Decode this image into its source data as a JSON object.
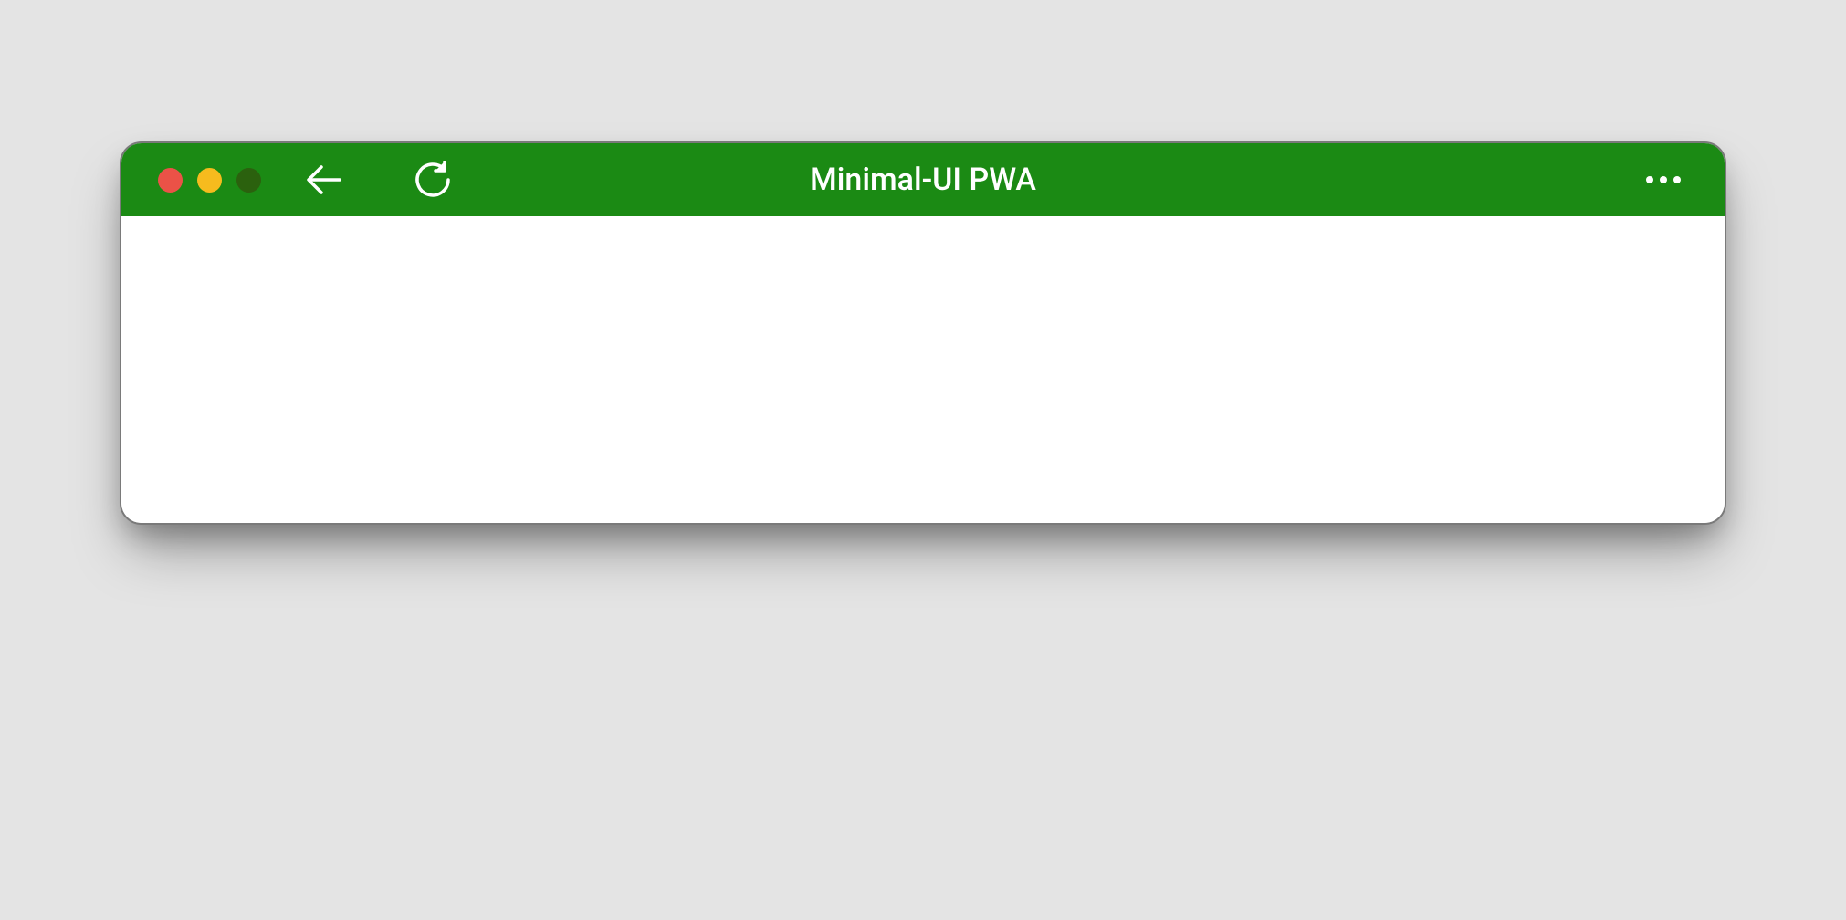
{
  "window": {
    "title": "Minimal-UI PWA"
  },
  "colors": {
    "titlebar": "#1b8a14",
    "traffic_close": "#eb5247",
    "traffic_minimize": "#f6bb1e",
    "traffic_maximize": "#2b610e"
  },
  "icons": {
    "back": "back-arrow-icon",
    "reload": "reload-icon",
    "more": "more-icon"
  }
}
